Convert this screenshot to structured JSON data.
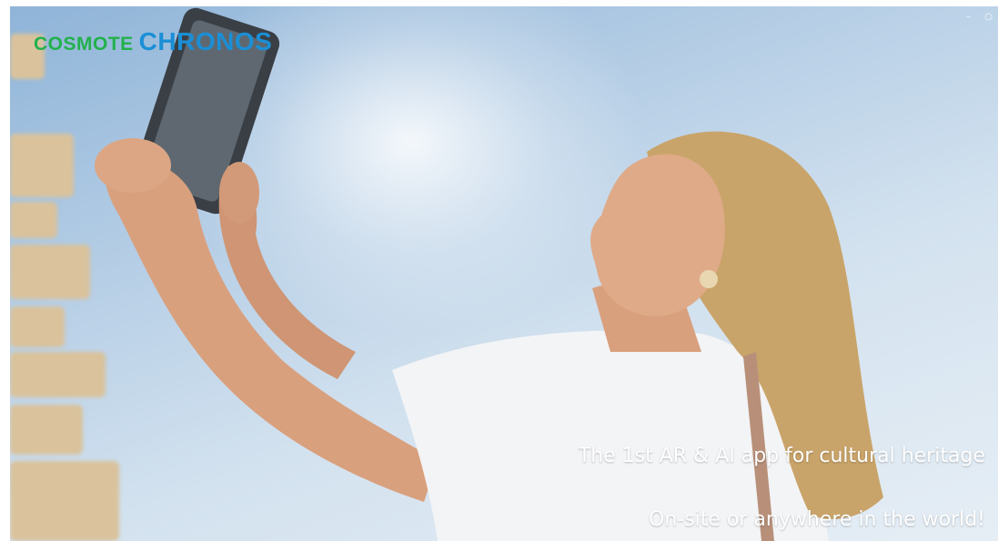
{
  "video": {
    "logo": {
      "brand": "COSMOTE",
      "product": "CHRONOS",
      "colors": {
        "brand": "#22b14c",
        "product": "#1a8fd6"
      }
    },
    "controls": {
      "minimize_icon": "minimize-icon",
      "settings_icon": "settings-icon"
    },
    "captions": [
      "The 1st AR & AI app for cultural heritage",
      "On-site or anywhere in the world!"
    ],
    "scene": {
      "description_icons": [
        "tablet-icon"
      ],
      "colors": {
        "sky_top": "#8fb4d8",
        "sky_bottom": "#e6eef5",
        "shirt": "#f3f4f6",
        "hair": "#c9a46a",
        "skin": "#d9a07e",
        "stone": "#d9c29c"
      }
    }
  }
}
